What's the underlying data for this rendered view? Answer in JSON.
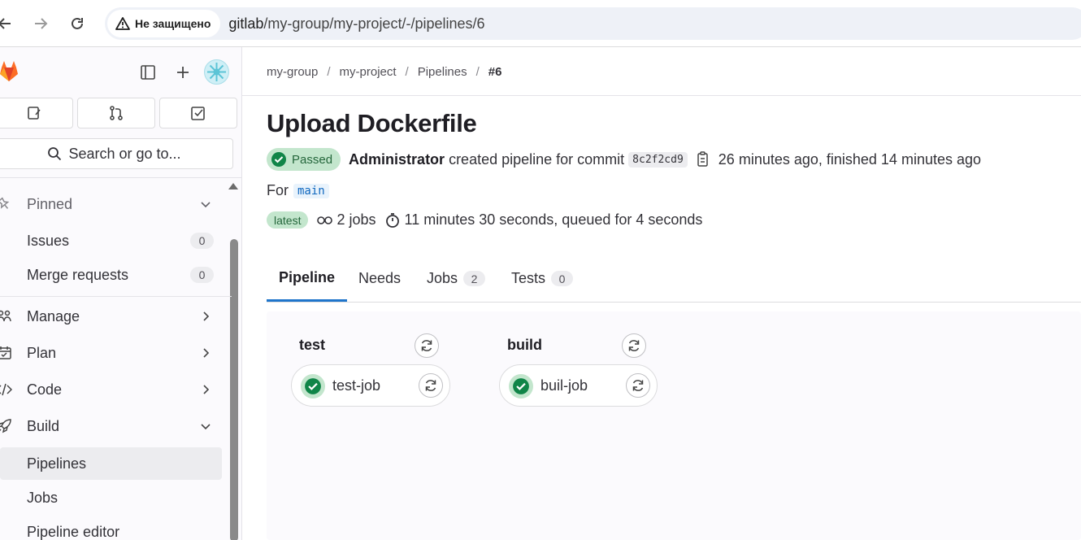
{
  "browser": {
    "security_label": "Не защищено",
    "url_host": "gitlab",
    "url_path": "/my-group/my-project/-/pipelines/6"
  },
  "sidebar": {
    "search_label": "Search or go to...",
    "pinned_label": "Pinned",
    "pinned_items": [
      {
        "label": "Issues",
        "count": "0"
      },
      {
        "label": "Merge requests",
        "count": "0"
      }
    ],
    "sections": [
      {
        "label": "Manage",
        "icon": "users-icon"
      },
      {
        "label": "Plan",
        "icon": "calendar-icon"
      },
      {
        "label": "Code",
        "icon": "code-icon"
      },
      {
        "label": "Build",
        "icon": "rocket-icon"
      }
    ],
    "build_items": [
      {
        "label": "Pipelines",
        "active": true
      },
      {
        "label": "Jobs",
        "active": false
      },
      {
        "label": "Pipeline editor",
        "active": false
      }
    ]
  },
  "breadcrumb": {
    "group": "my-group",
    "project": "my-project",
    "section": "Pipelines",
    "current": "#6"
  },
  "pipeline": {
    "title": "Upload Dockerfile",
    "status": "Passed",
    "author": "Administrator",
    "action_text": "created pipeline for commit",
    "commit_sha": "8c2f2cd9",
    "timing": "26 minutes ago, finished 14 minutes ago",
    "for_label": "For",
    "branch": "main",
    "latest_badge": "latest",
    "jobs_text": "2 jobs",
    "duration_text": "11 minutes 30 seconds, queued for 4 seconds"
  },
  "tabs": [
    {
      "label": "Pipeline",
      "count": null,
      "active": true
    },
    {
      "label": "Needs",
      "count": null,
      "active": false
    },
    {
      "label": "Jobs",
      "count": "2",
      "active": false
    },
    {
      "label": "Tests",
      "count": "0",
      "active": false
    }
  ],
  "stages": [
    {
      "name": "test",
      "jobs": [
        {
          "name": "test-job",
          "status": "success"
        }
      ]
    },
    {
      "name": "build",
      "jobs": [
        {
          "name": "buil-job",
          "status": "success"
        }
      ]
    }
  ],
  "colors": {
    "success": "#108548",
    "success_bg": "#c3e6cd",
    "link": "#1068bf",
    "tab_active": "#1f75cb",
    "gitlab_orange": "#fc6d26"
  }
}
